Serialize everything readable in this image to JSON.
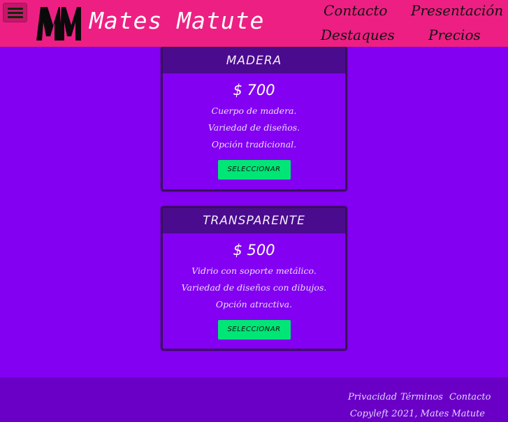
{
  "header": {
    "menu_icon": "hamburger-icon",
    "logo_icon": "mm-logo-icon",
    "title": "Mates Matute",
    "nav": {
      "contacto": "Contacto",
      "presentacion": "Presentación",
      "destaques": "Destaques",
      "precios": "Precios"
    },
    "colors": {
      "bar": "#ee1f83",
      "menu_button": "#c2186a"
    }
  },
  "cards": [
    {
      "title": "MADERA",
      "price": "$ 700",
      "features": [
        "Cuerpo de madera.",
        "Variedad de diseños.",
        "Opción tradicional."
      ],
      "button": "SELECCIONAR"
    },
    {
      "title": "TRANSPARENTE",
      "price": "$ 500",
      "features": [
        "Vidrio con soporte metálico.",
        "Variedad de diseños con dibujos.",
        "Opción atractiva."
      ],
      "button": "SELECCIONAR"
    }
  ],
  "footer": {
    "links": {
      "privacidad": "Privacidad",
      "terminos": "Términos",
      "contacto": "Contacto"
    },
    "copyleft": "Copyleft 2021, Mates Matute"
  },
  "colors": {
    "background": "#8300f2",
    "card_header": "#4b0b8e",
    "button": "#00e676",
    "footer": "#6a00c6"
  }
}
